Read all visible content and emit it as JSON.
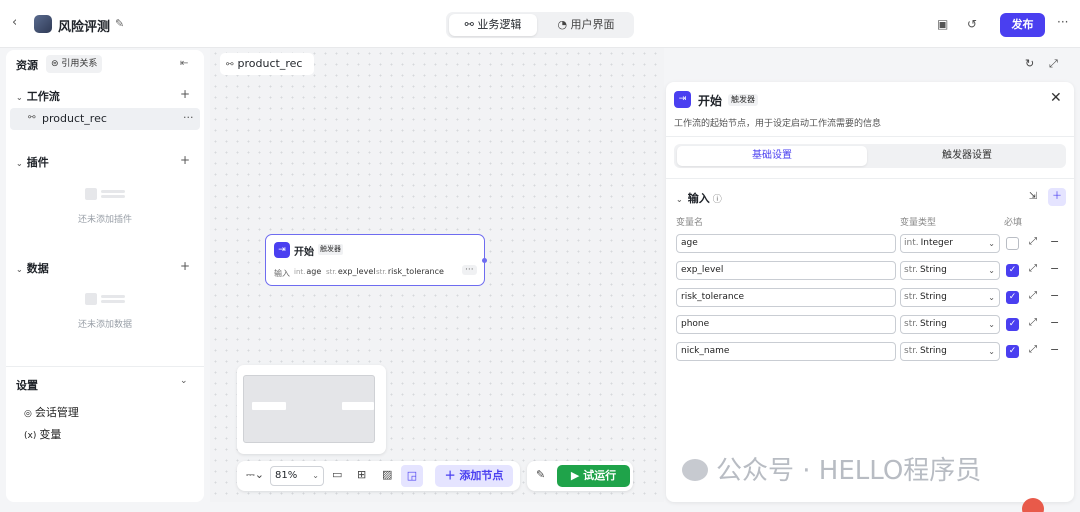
{
  "header": {
    "title": "风险评测",
    "tabs": [
      {
        "label": "业务逻辑",
        "icon": "flow-icon"
      },
      {
        "label": "用户界面",
        "icon": "palette-icon"
      }
    ],
    "publish_label": "发布"
  },
  "sidebar": {
    "header": "资源",
    "ref_label": "引用关系",
    "workflow": {
      "title": "工作流",
      "item": "product_rec"
    },
    "plugin": {
      "title": "插件",
      "empty": "还未添加插件"
    },
    "data": {
      "title": "数据",
      "empty": "还未添加数据"
    },
    "settings": {
      "title": "设置",
      "items": [
        "会话管理",
        "变量"
      ]
    }
  },
  "canvas": {
    "tab": "product_rec",
    "node": {
      "title": "开始",
      "badge": "触发器",
      "input_label": "输入",
      "vars": [
        {
          "type": "int.",
          "name": "age"
        },
        {
          "type": "str.",
          "name": "exp_level"
        },
        {
          "type": "str.",
          "name": "risk_tolerance"
        }
      ]
    },
    "toolbar": {
      "zoom": "81%",
      "add_node": "添加节点",
      "run": "试运行"
    }
  },
  "panel": {
    "title": "开始",
    "badge": "触发器",
    "description": "工作流的起始节点，用于设定启动工作流需要的信息",
    "tabs": [
      "基础设置",
      "触发器设置"
    ],
    "input_title": "输入",
    "columns": [
      "变量名",
      "变量类型",
      "必填"
    ],
    "rows": [
      {
        "name": "age",
        "type_prefix": "int.",
        "type": "Integer",
        "required": false
      },
      {
        "name": "exp_level",
        "type_prefix": "str.",
        "type": "String",
        "required": true
      },
      {
        "name": "risk_tolerance",
        "type_prefix": "str.",
        "type": "String",
        "required": true
      },
      {
        "name": "phone",
        "type_prefix": "str.",
        "type": "String",
        "required": true
      },
      {
        "name": "nick_name",
        "type_prefix": "str.",
        "type": "String",
        "required": true
      }
    ]
  },
  "watermark": "公众号 · HELLO程序员",
  "colors": {
    "accent": "#4a3ff0",
    "run": "#1fa34a"
  }
}
